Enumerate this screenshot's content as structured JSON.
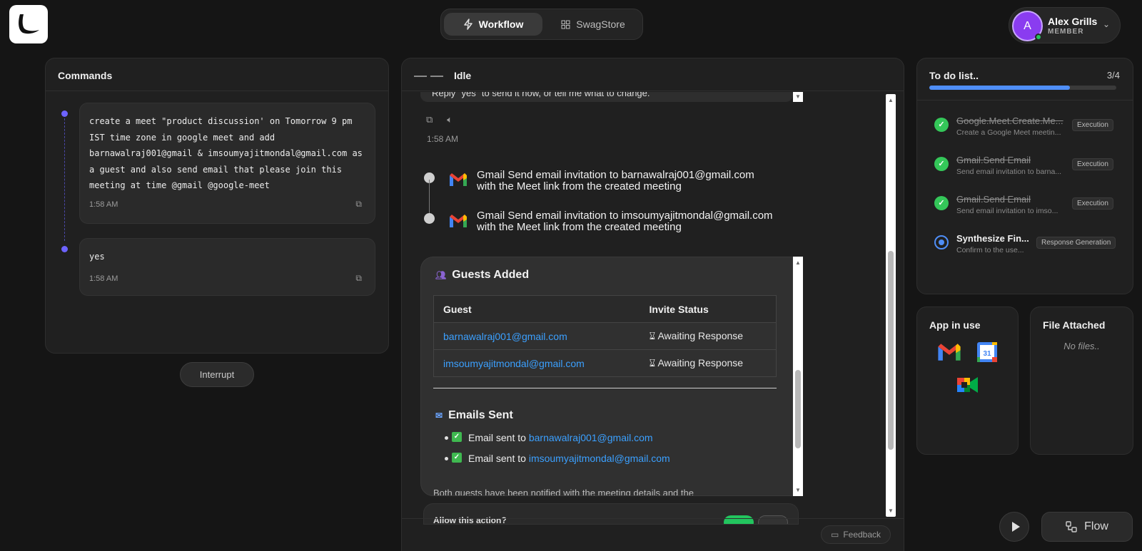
{
  "topbar": {
    "tabs": [
      {
        "label": "Workflow",
        "active": true
      },
      {
        "label": "SwagStore",
        "active": false
      }
    ],
    "user": {
      "initial": "A",
      "name": "Alex Grills",
      "role": "MEMBER"
    }
  },
  "commands": {
    "title": "Commands",
    "messages": [
      {
        "text": "create a meet \"product discussion' on Tomorrow 9 pm IST time zone in google meet and add barnawalraj001@gmail & imsoumyajitmondal@gmail.com as a guest and also send email that please join this meeting at time @gmail @google-meet",
        "time": "1:58 AM"
      },
      {
        "text": "yes",
        "time": "1:58 AM"
      }
    ],
    "interrupt_label": "Interrupt"
  },
  "conversation": {
    "status": "Idle",
    "reply_snippet": "Reply \"yes\" to send it now, or tell me what to change.",
    "time": "1:58 AM",
    "steps": [
      {
        "line1": "Gmail Send email invitation to barnawalraj001@gmail.com",
        "line2": "with the Meet link from the created meeting"
      },
      {
        "line1": "Gmail Send email invitation to imsoumyajitmondal@gmail.com",
        "line2": "with the Meet link from the created meeting"
      }
    ],
    "guests_title": "Guests Added",
    "table_headers": {
      "guest": "Guest",
      "status": "Invite Status"
    },
    "guests": [
      {
        "email": "barnawalraj001@gmail.com",
        "status": "Awaiting Response"
      },
      {
        "email": "imsoumyajitmondal@gmail.com",
        "status": "Awaiting Response"
      }
    ],
    "emails_title": "Emails Sent",
    "emails": [
      {
        "prefix": "Email sent to ",
        "email": "barnawalraj001@gmail.com"
      },
      {
        "prefix": "Email sent to ",
        "email": "imsoumyajitmondal@gmail.com"
      }
    ],
    "cut_text": "Both guests have been notified with the meeting details and the",
    "allow_text": "Allow this action?",
    "feedback_label": "Feedback"
  },
  "todo": {
    "title": "To do list..",
    "count": "3/4",
    "progress": 0.75,
    "items": [
      {
        "name": "Google.Meet.Create.Me...",
        "sub": "Create a Google Meet meetin...",
        "tag": "Execution",
        "done": true
      },
      {
        "name": "Gmail.Send Email",
        "sub": "Send email invitation to barna...",
        "tag": "Execution",
        "done": true
      },
      {
        "name": "Gmail.Send Email",
        "sub": "Send email invitation to imso...",
        "tag": "Execution",
        "done": true
      },
      {
        "name": "Synthesize Fin...",
        "sub": "Confirm to the use...",
        "tag": "Response Generation",
        "done": false
      }
    ]
  },
  "apps": {
    "title": "App in use",
    "icons": [
      "gmail-icon",
      "google-calendar-icon",
      "google-meet-icon"
    ],
    "calendar_day": "31"
  },
  "files": {
    "title": "File Attached",
    "empty_text": "No files.."
  },
  "bottom": {
    "flow_label": "Flow"
  },
  "colors": {
    "accent": "#4f8ef7",
    "link": "#3ba0ff",
    "success": "#34c759",
    "background": "#151515"
  }
}
